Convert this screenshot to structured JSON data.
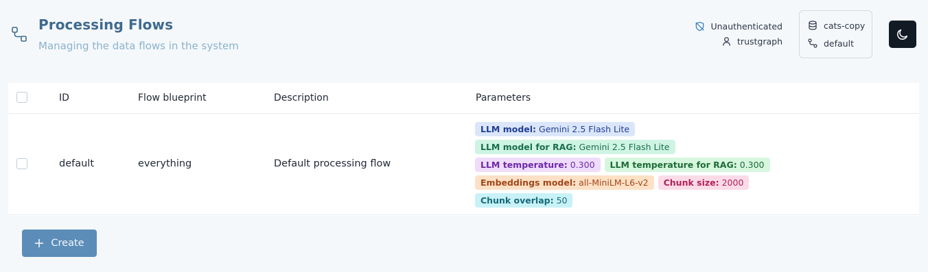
{
  "header": {
    "title": "Processing Flows",
    "subtitle": "Managing the data flows in the system"
  },
  "auth": {
    "status": "Unauthenticated",
    "user": "trustgraph"
  },
  "workspace": {
    "collection": "cats-copy",
    "flow": "default"
  },
  "table": {
    "columns": [
      "ID",
      "Flow blueprint",
      "Description",
      "Parameters"
    ],
    "rows": [
      {
        "id": "default",
        "blueprint": "everything",
        "description": "Default processing flow",
        "params": [
          {
            "key": "LLM model:",
            "value": "Gemini 2.5 Flash Lite"
          },
          {
            "key": "LLM model for RAG:",
            "value": "Gemini 2.5 Flash Lite"
          },
          {
            "key": "LLM temperature:",
            "value": "0.300"
          },
          {
            "key": "LLM temperature for RAG:",
            "value": "0.300"
          },
          {
            "key": "Embeddings model:",
            "value": "all-MiniLM-L6-v2"
          },
          {
            "key": "Chunk size:",
            "value": "2000"
          },
          {
            "key": "Chunk overlap:",
            "value": "50"
          }
        ]
      }
    ]
  },
  "actions": {
    "create_label": "Create"
  },
  "icons": {
    "flow": "flow-icon",
    "auth": "shield-off-icon",
    "user": "user-icon",
    "collection": "database-icon",
    "flow_link": "route-icon",
    "theme": "moon-icon",
    "create": "plus-icon"
  },
  "colors": {
    "title": "#3f6a8e",
    "primary_button": "#5b8db8",
    "theme_button": "#121a24"
  }
}
